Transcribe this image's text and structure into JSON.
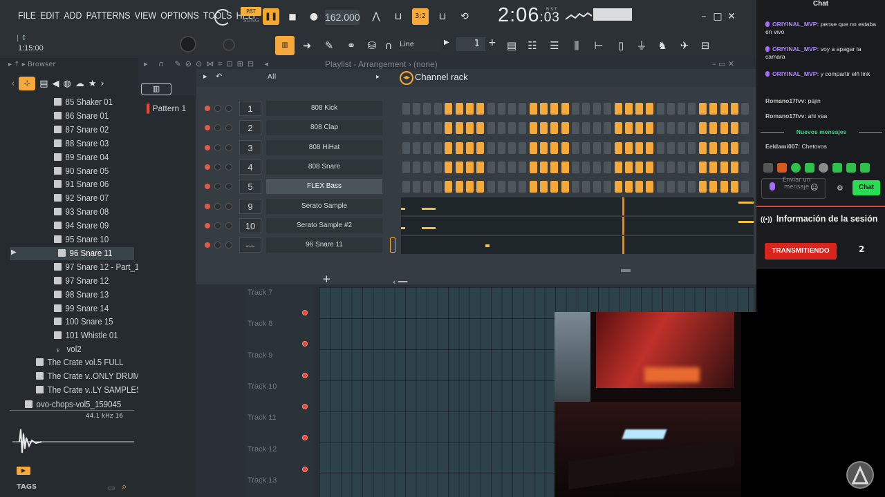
{
  "menu": [
    "FILE",
    "EDIT",
    "ADD",
    "PATTERNS",
    "VIEW",
    "OPTIONS",
    "TOOLS",
    "HELP"
  ],
  "transport": {
    "pat": "PAT",
    "song": "SONG",
    "tempo": "162.000",
    "time_main": "2:06",
    "time_sub": "03",
    "time_unit": "B:S:T",
    "pause_icon": "pause-icon",
    "stop_icon": "stop-icon",
    "record_icon": "record-icon"
  },
  "hint": {
    "time": "1:15:00"
  },
  "toolbar": {
    "snap": "Line",
    "pattern_num": "1"
  },
  "browser": {
    "header": "Browser",
    "items": [
      {
        "label": "85 Shaker 01"
      },
      {
        "label": "86 Snare 01"
      },
      {
        "label": "87 Snare 02"
      },
      {
        "label": "88 Snare 03"
      },
      {
        "label": "89 Snare 04"
      },
      {
        "label": "90 Snare 05"
      },
      {
        "label": "91 Snare 06"
      },
      {
        "label": "92 Snare 07"
      },
      {
        "label": "93 Snare 08"
      },
      {
        "label": "94 Snare 09"
      },
      {
        "label": "95 Snare 10"
      },
      {
        "label": "96 Snare 11"
      },
      {
        "label": "97 Snare 12 - Part_1"
      },
      {
        "label": "97 Snare 12"
      },
      {
        "label": "98 Snare 13"
      },
      {
        "label": "99 Snare 14"
      },
      {
        "label": "100 Snare 15"
      },
      {
        "label": "101 Whistle 01"
      },
      {
        "label": "vol2"
      }
    ],
    "folders": [
      {
        "label": "The Crate vol.5 FULL"
      },
      {
        "label": "The Crate v..ONLY DRUMS"
      },
      {
        "label": "The Crate v..LY SAMPLES"
      },
      {
        "label": "ovo-chops-vol5_159045"
      }
    ],
    "sample_rate": "44.1 kHz 16",
    "tags": "TAGS"
  },
  "playlist": {
    "title": "Playlist - Arrangement › (none)",
    "pattern": "Pattern 1",
    "tracks": [
      "Track 7",
      "Track 8",
      "Track 9",
      "Track 10",
      "Track 11",
      "Track 12",
      "Track 13"
    ]
  },
  "rack": {
    "title": "Channel rack",
    "filter": "All",
    "channels": [
      {
        "num": "1",
        "name": "808 Kick"
      },
      {
        "num": "2",
        "name": "808 Clap"
      },
      {
        "num": "3",
        "name": "808 HiHat"
      },
      {
        "num": "4",
        "name": "808 Snare"
      },
      {
        "num": "5",
        "name": "FLEX Bass"
      },
      {
        "num": "9",
        "name": "Serato Sample"
      },
      {
        "num": "10",
        "name": "Serato Sample #2"
      },
      {
        "num": "---",
        "name": "96 Snare 11"
      }
    ],
    "steps_pattern": [
      0,
      0,
      0,
      0,
      1,
      1,
      1,
      1,
      0,
      0,
      0,
      0,
      1,
      1,
      1,
      1,
      0,
      0,
      0,
      0,
      1,
      1,
      1,
      1,
      0,
      0,
      0,
      0,
      1,
      1,
      1,
      1,
      0
    ]
  },
  "chat": {
    "title": "Chat",
    "messages": [
      {
        "user": "ORIYINAL_MVP:",
        "text": " pense que no estaba en vivo",
        "type": "o"
      },
      {
        "user": "ORIYINAL_MVP:",
        "text": " voy a apagar la camara",
        "type": "o"
      },
      {
        "user": "ORIYINAL_MVP:",
        "text": " y compartir elñ link",
        "type": "o"
      },
      {
        "user": "Romano17fvv:",
        "text": " pajin",
        "type": "r"
      },
      {
        "user": "Romano17fvv:",
        "text": " ahi vaa",
        "type": "r"
      },
      {
        "user": "Eeldami007:",
        "text": " Chetovos",
        "type": "r"
      }
    ],
    "new_messages": "Nuevos mensajes",
    "send_placeholder": "Enviar un mensaje",
    "send_button": "Chat",
    "session_info": "Información de la sesión",
    "live_label": "TRANSMITIENDO",
    "viewers": "2"
  },
  "colors": {
    "accent": "#f4a93a",
    "step_off": "#4c565c",
    "chat_green": "#29dc54",
    "live_red": "#d8241a"
  }
}
